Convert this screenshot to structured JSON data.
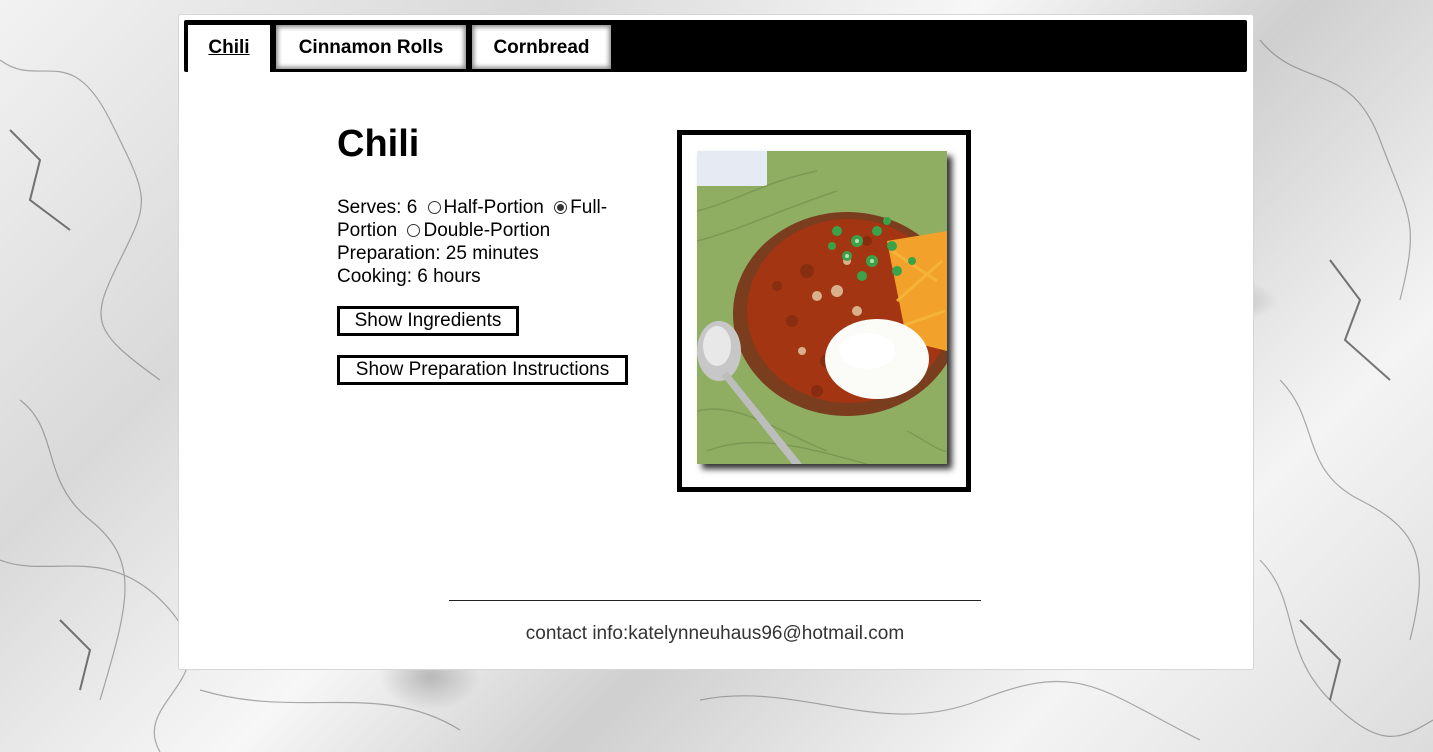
{
  "tabs": [
    {
      "label": "Chili",
      "active": true
    },
    {
      "label": "Cinnamon Rolls",
      "active": false
    },
    {
      "label": "Cornbread",
      "active": false
    }
  ],
  "recipe": {
    "title": "Chili",
    "serves_label": "Serves: 6",
    "portions": [
      {
        "label": "Half-Portion",
        "selected": false
      },
      {
        "label": "Full-Portion",
        "selected": true
      },
      {
        "label": "Double-Portion",
        "selected": false
      }
    ],
    "preparation": "Preparation: 25 minutes",
    "cooking": "Cooking: 6 hours",
    "image_alt": "bowl of chili with sour cream, cheese and green onions"
  },
  "buttons": {
    "show_ingredients": "Show Ingredients",
    "show_instructions": "Show Preparation Instructions"
  },
  "footer": {
    "contact": "contact info:katelynneuhaus96@hotmail.com"
  },
  "colors": {
    "tabbar": "#000000",
    "card": "#ffffff",
    "frame": "#000000",
    "napkin": "#86a65a",
    "chili": "#b03a14",
    "bowl": "#8b4a26"
  }
}
